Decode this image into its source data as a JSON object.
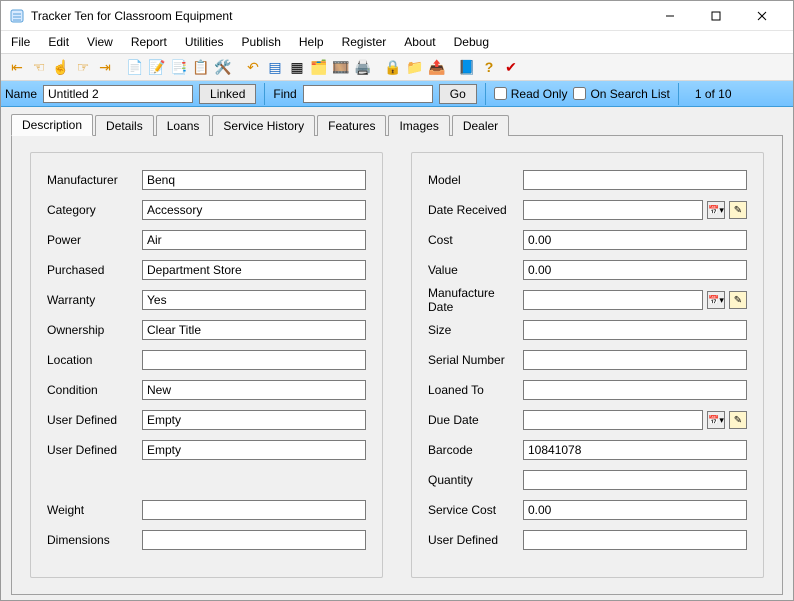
{
  "window": {
    "title": "Tracker Ten for Classroom Equipment"
  },
  "menu": {
    "file": "File",
    "edit": "Edit",
    "view": "View",
    "report": "Report",
    "utilities": "Utilities",
    "publish": "Publish",
    "help": "Help",
    "register": "Register",
    "about": "About",
    "debug": "Debug"
  },
  "infobar": {
    "name_label": "Name",
    "name_value": "Untitled 2",
    "linked": "Linked",
    "find_label": "Find",
    "find_value": "",
    "go": "Go",
    "readonly": "Read Only",
    "on_search": "On Search List",
    "counter": "1 of 10"
  },
  "tabs": {
    "description": "Description",
    "details": "Details",
    "loans": "Loans",
    "service": "Service History",
    "features": "Features",
    "images": "Images",
    "dealer": "Dealer"
  },
  "left": {
    "manufacturer": {
      "label": "Manufacturer",
      "value": "Benq"
    },
    "category": {
      "label": "Category",
      "value": "Accessory"
    },
    "power": {
      "label": "Power",
      "value": "Air"
    },
    "purchased": {
      "label": "Purchased",
      "value": "Department Store"
    },
    "warranty": {
      "label": "Warranty",
      "value": "Yes"
    },
    "ownership": {
      "label": "Ownership",
      "value": "Clear Title"
    },
    "location": {
      "label": "Location",
      "value": ""
    },
    "condition": {
      "label": "Condition",
      "value": "New"
    },
    "ud1": {
      "label": "User Defined",
      "value": "Empty"
    },
    "ud2": {
      "label": "User Defined",
      "value": "Empty"
    },
    "weight": {
      "label": "Weight",
      "value": ""
    },
    "dimensions": {
      "label": "Dimensions",
      "value": ""
    }
  },
  "right": {
    "model": {
      "label": "Model",
      "value": ""
    },
    "date_received": {
      "label": "Date Received",
      "value": ""
    },
    "cost": {
      "label": "Cost",
      "value": "0.00"
    },
    "value": {
      "label": "Value",
      "value": "0.00"
    },
    "mfg_date": {
      "label": "Manufacture Date",
      "value": ""
    },
    "size": {
      "label": "Size",
      "value": ""
    },
    "serial": {
      "label": "Serial Number",
      "value": ""
    },
    "loaned_to": {
      "label": "Loaned To",
      "value": ""
    },
    "due_date": {
      "label": "Due Date",
      "value": ""
    },
    "barcode": {
      "label": "Barcode",
      "value": "10841078"
    },
    "quantity": {
      "label": "Quantity",
      "value": ""
    },
    "service_cost": {
      "label": "Service Cost",
      "value": "0.00"
    },
    "ud": {
      "label": "User Defined",
      "value": ""
    }
  }
}
